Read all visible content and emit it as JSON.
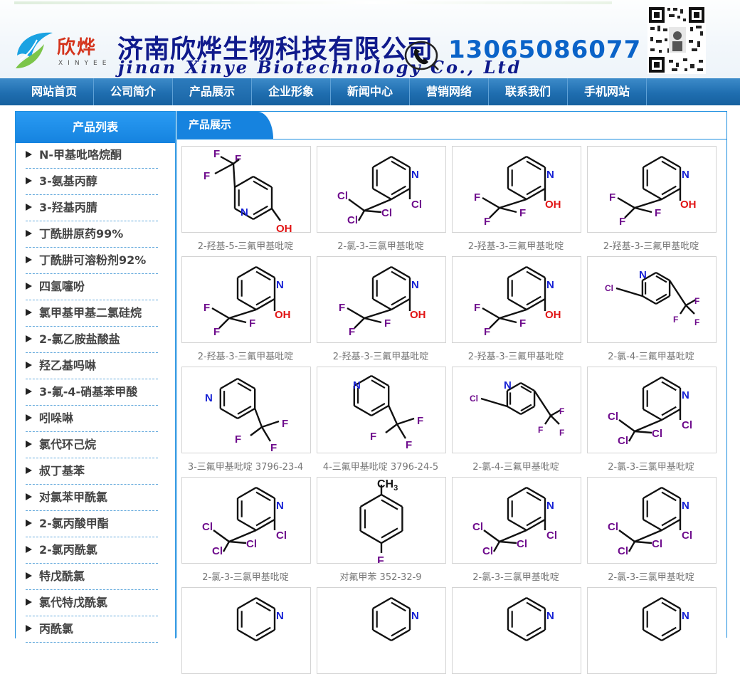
{
  "header": {
    "logo_cn": "欣烨",
    "logo_en": "XINYEE",
    "company_cn": "济南欣烨生物科技有限公司",
    "company_en": "jinan Xinye Biotechnology Co., Ltd",
    "phone": "13065086077",
    "brand_color": "#0f1a8c",
    "phone_color": "#0a63c8"
  },
  "nav": {
    "items": [
      "网站首页",
      "公司简介",
      "产品展示",
      "企业形象",
      "新闻中心",
      "营销网络",
      "联系我们",
      "手机网站"
    ],
    "active": "产品展示"
  },
  "sidebar": {
    "title": "产品列表",
    "items": [
      "N-甲基吡咯烷酮",
      "3-氨基丙醇",
      "3-羟基丙腈",
      "丁酰肼原药99%",
      "丁酰肼可溶粉剂92%",
      "四氢噻吩",
      "氯甲基甲基二氯硅烷",
      "2-氯乙胺盐酸盐",
      "羟乙基吗啉",
      "3-氟-4-硝基苯甲酸",
      "吲哚啉",
      "氯代环己烷",
      "叔丁基苯",
      "对氯苯甲酰氯",
      "2-氯丙酸甲酯",
      "2-氯丙酰氯",
      "特戊酰氯",
      "氯代特戊酰氯",
      "丙酰氯"
    ]
  },
  "main": {
    "tab": "产品展示",
    "products": [
      {
        "caption": "2-羟基-5-三氟甲基吡啶",
        "icon": "structure-2-hydroxy-5-trifluoromethylpyridine"
      },
      {
        "caption": "2-氯-3-三氯甲基吡啶",
        "icon": "structure-2-chloro-3-trichloromethylpyridine"
      },
      {
        "caption": "2-羟基-3-三氟甲基吡啶",
        "icon": "structure-2-hydroxy-3-trifluoromethylpyridine"
      },
      {
        "caption": "2-羟基-3-三氟甲基吡啶",
        "icon": "structure-2-hydroxy-3-trifluoromethylpyridine"
      },
      {
        "caption": "2-羟基-3-三氟甲基吡啶",
        "icon": "structure-2-hydroxy-3-trifluoromethylpyridine"
      },
      {
        "caption": "2-羟基-3-三氟甲基吡啶",
        "icon": "structure-2-hydroxy-3-trifluoromethylpyridine"
      },
      {
        "caption": "2-羟基-3-三氟甲基吡啶",
        "icon": "structure-2-hydroxy-3-trifluoromethylpyridine"
      },
      {
        "caption": "2-氯-4-三氟甲基吡啶",
        "icon": "structure-2-chloro-4-trifluoromethylpyridine"
      },
      {
        "caption": "3-三氟甲基吡啶 3796-23-4",
        "icon": "structure-3-trifluoromethylpyridine"
      },
      {
        "caption": "4-三氟甲基吡啶 3796-24-5",
        "icon": "structure-4-trifluoromethylpyridine"
      },
      {
        "caption": "2-氯-4-三氟甲基吡啶",
        "icon": "structure-2-chloro-4-trifluoromethylpyridine"
      },
      {
        "caption": "2-氯-3-三氯甲基吡啶",
        "icon": "structure-2-chloro-3-trichloromethylpyridine"
      },
      {
        "caption": "2-氯-3-三氯甲基吡啶",
        "icon": "structure-2-chloro-3-trichloromethylpyridine"
      },
      {
        "caption": "对氟甲苯 352-32-9",
        "icon": "structure-4-fluorotoluene"
      },
      {
        "caption": "2-氯-3-三氯甲基吡啶",
        "icon": "structure-2-chloro-3-trichloromethylpyridine"
      },
      {
        "caption": "2-氯-3-三氯甲基吡啶",
        "icon": "structure-2-chloro-3-trichloromethylpyridine"
      },
      {
        "caption": "",
        "icon": "structure-pyridine"
      },
      {
        "caption": "",
        "icon": "structure-pyridine"
      },
      {
        "caption": "",
        "icon": "structure-pyridine"
      },
      {
        "caption": "",
        "icon": "structure-pyridine"
      }
    ]
  }
}
